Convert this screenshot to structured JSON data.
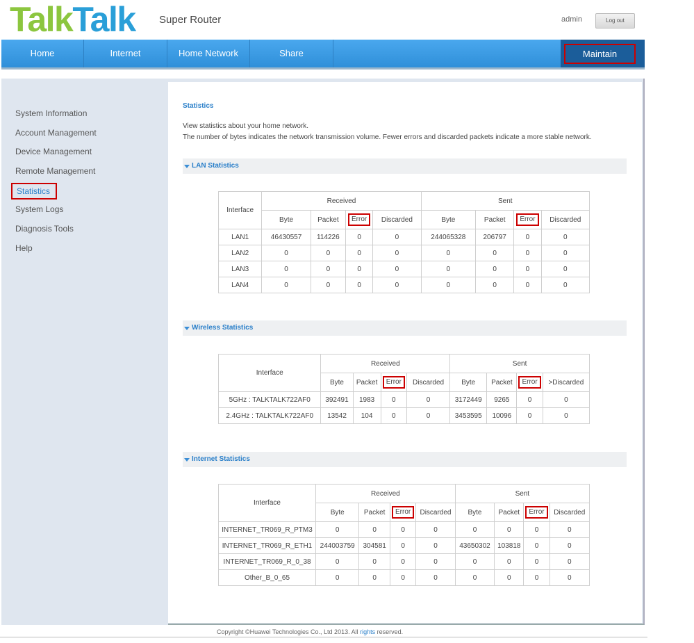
{
  "header": {
    "logo_part1": "Talk",
    "logo_part2": "Talk",
    "product": "Super Router",
    "user": "admin",
    "logout_label": "Log out"
  },
  "nav": {
    "home": "Home",
    "internet": "Internet",
    "home_network": "Home Network",
    "share": "Share",
    "maintain": "Maintain"
  },
  "sidebar": {
    "items": [
      {
        "label": "System Information"
      },
      {
        "label": "Account Management"
      },
      {
        "label": "Device Management"
      },
      {
        "label": "Remote Management"
      },
      {
        "label": "Statistics"
      },
      {
        "label": "System Logs"
      },
      {
        "label": "Diagnosis Tools"
      },
      {
        "label": "Help"
      }
    ]
  },
  "main": {
    "title": "Statistics",
    "desc1": "View statistics about your home network.",
    "desc2": "The number of bytes indicates the network transmission volume. Fewer errors and discarded packets indicate a more stable network."
  },
  "lan": {
    "section": "LAN Statistics",
    "h_interface": "Interface",
    "h_received": "Received",
    "h_sent": "Sent",
    "cols": [
      "Byte",
      "Packet",
      "Error",
      "Discarded",
      "Byte",
      "Packet",
      "Error",
      "Discarded"
    ],
    "rows": [
      [
        "LAN1",
        "46430557",
        "114226",
        "0",
        "0",
        "244065328",
        "206797",
        "0",
        "0"
      ],
      [
        "LAN2",
        "0",
        "0",
        "0",
        "0",
        "0",
        "0",
        "0",
        "0"
      ],
      [
        "LAN3",
        "0",
        "0",
        "0",
        "0",
        "0",
        "0",
        "0",
        "0"
      ],
      [
        "LAN4",
        "0",
        "0",
        "0",
        "0",
        "0",
        "0",
        "0",
        "0"
      ]
    ]
  },
  "wireless": {
    "section": "Wireless Statistics",
    "h_interface": "Interface",
    "h_received": "Received",
    "h_sent": "Sent",
    "cols": [
      "Byte",
      "Packet",
      "Error",
      "Discarded",
      "Byte",
      "Packet",
      "Error",
      ">Discarded"
    ],
    "rows": [
      [
        "5GHz : TALKTALK722AF0",
        "392491",
        "1983",
        "0",
        "0",
        "3172449",
        "9265",
        "0",
        "0"
      ],
      [
        "2.4GHz : TALKTALK722AF0",
        "13542",
        "104",
        "0",
        "0",
        "3453595",
        "10096",
        "0",
        "0"
      ]
    ]
  },
  "internet": {
    "section": "Internet Statistics",
    "h_interface": "Interface",
    "h_received": "Received",
    "h_sent": "Sent",
    "cols": [
      "Byte",
      "Packet",
      "Error",
      "Discarded",
      "Byte",
      "Packet",
      "Error",
      "Discarded"
    ],
    "rows": [
      [
        "INTERNET_TR069_R_PTM3",
        "0",
        "0",
        "0",
        "0",
        "0",
        "0",
        "0",
        "0"
      ],
      [
        "INTERNET_TR069_R_ETH1",
        "244003759",
        "304581",
        "0",
        "0",
        "43650302",
        "103818",
        "0",
        "0"
      ],
      [
        "INTERNET_TR069_R_0_38",
        "0",
        "0",
        "0",
        "0",
        "0",
        "0",
        "0",
        "0"
      ],
      [
        "Other_B_0_65",
        "0",
        "0",
        "0",
        "0",
        "0",
        "0",
        "0",
        "0"
      ]
    ]
  },
  "footer": {
    "prefix": "Copyright ©Huawei Technologies Co., Ltd 2013. All ",
    "link": "rights",
    "suffix": " reserved."
  }
}
